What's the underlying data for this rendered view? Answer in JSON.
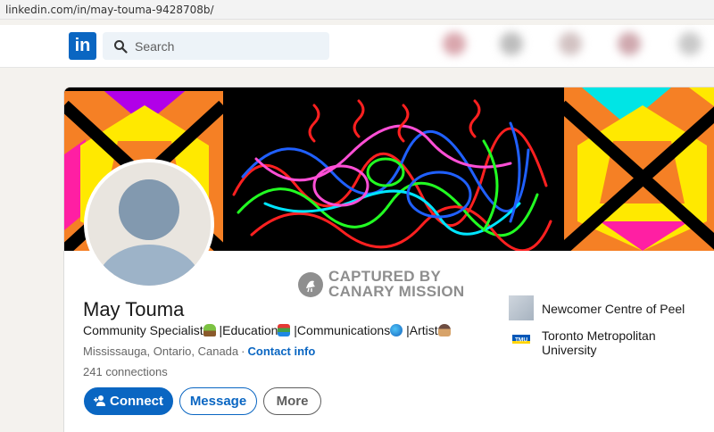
{
  "browser": {
    "url": "linkedin.com/in/may-touma-9428708b/"
  },
  "nav": {
    "logo_text": "in",
    "search_placeholder": "Search"
  },
  "profile": {
    "name": "May Touma",
    "headline": {
      "part1": "Community Specialist",
      "part2": " |Education",
      "part3": " |Communications",
      "part4": " |Artist"
    },
    "location": "Mississauga, Ontario, Canada",
    "separator": "·",
    "contact_info_label": "Contact info",
    "connections_count": "241",
    "connections_label": " connections"
  },
  "watermark": {
    "line1": "CAPTURED BY",
    "line2": "CANARY MISSION"
  },
  "organizations": [
    {
      "name": "Newcomer Centre of Peel"
    },
    {
      "name": "Toronto Metropolitan University",
      "logo_text": "TMU"
    }
  ],
  "actions": {
    "connect_label": "Connect",
    "message_label": "Message",
    "more_label": "More"
  },
  "colors": {
    "brand": "#0a66c2",
    "search_bg": "#edf3f8",
    "page_bg": "#f4f2ee"
  }
}
